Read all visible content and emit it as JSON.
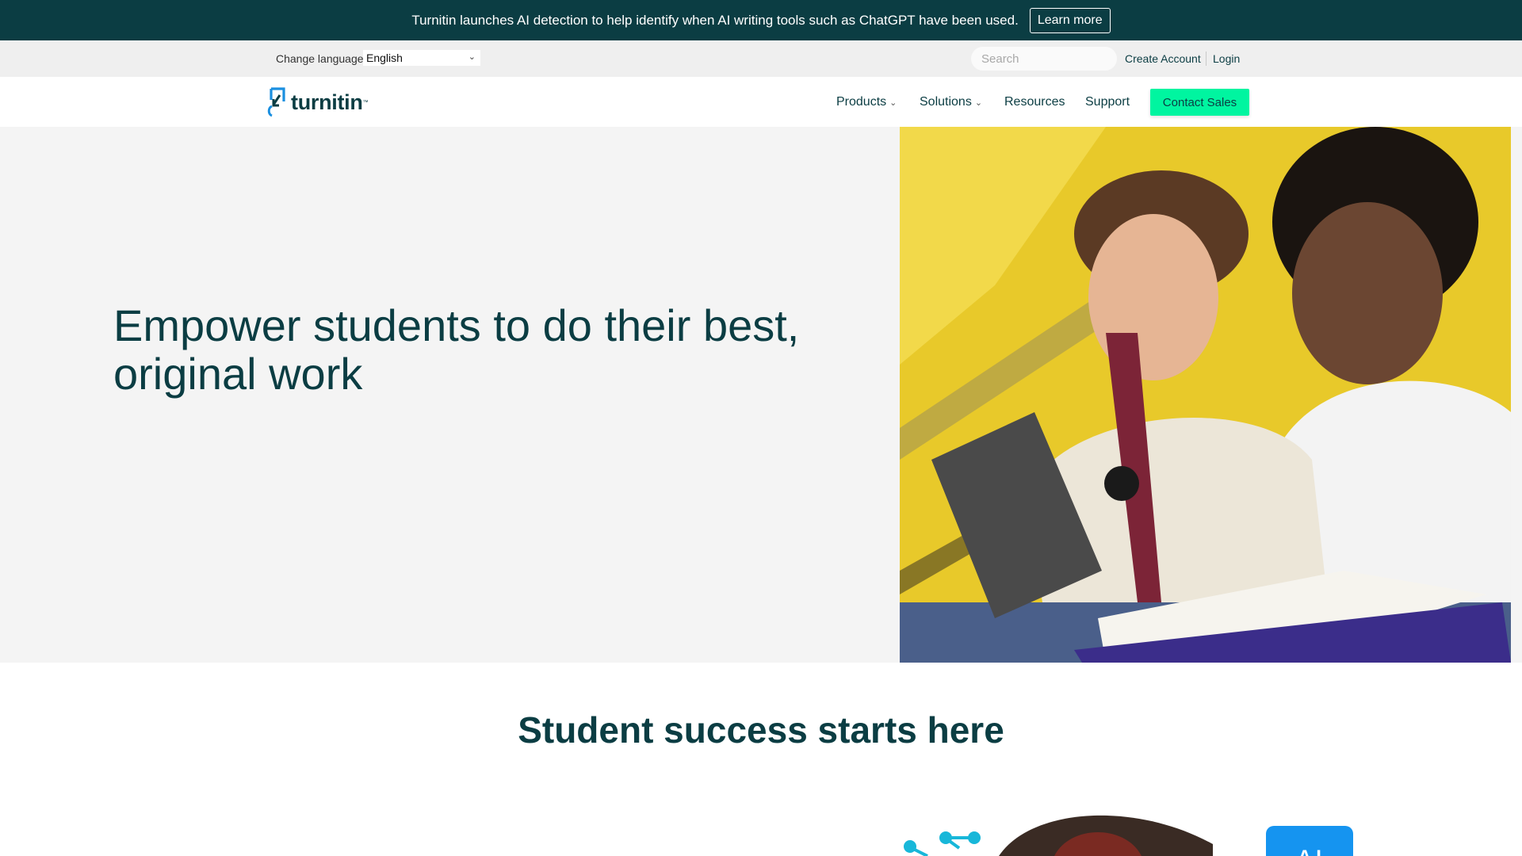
{
  "announcement": {
    "text": "Turnitin launches AI detection to help identify when AI writing tools such as ChatGPT have been used.",
    "button_label": "Learn more"
  },
  "utility_bar": {
    "language_label": "Change language",
    "language_selected": "English",
    "search_placeholder": "Search",
    "create_account": "Create Account",
    "login": "Login"
  },
  "navbar": {
    "logo_text": "turnitin",
    "items": [
      {
        "label": "Products",
        "has_dropdown": true
      },
      {
        "label": "Solutions",
        "has_dropdown": true
      },
      {
        "label": "Resources",
        "has_dropdown": false
      },
      {
        "label": "Support",
        "has_dropdown": false
      }
    ],
    "cta_label": "Contact Sales"
  },
  "hero": {
    "title_line1": "Empower students to do their best,",
    "title_line2": "original work"
  },
  "section": {
    "title": "Student success starts here",
    "badge_text": "A I"
  },
  "colors": {
    "brand_dark": "#0b3d43",
    "accent_green": "#00f5a0",
    "logo_blue": "#1a8fe0",
    "hero_bg": "#f4f4f4",
    "deco_cyan": "#18b7d9",
    "badge_blue": "#1594f0"
  }
}
